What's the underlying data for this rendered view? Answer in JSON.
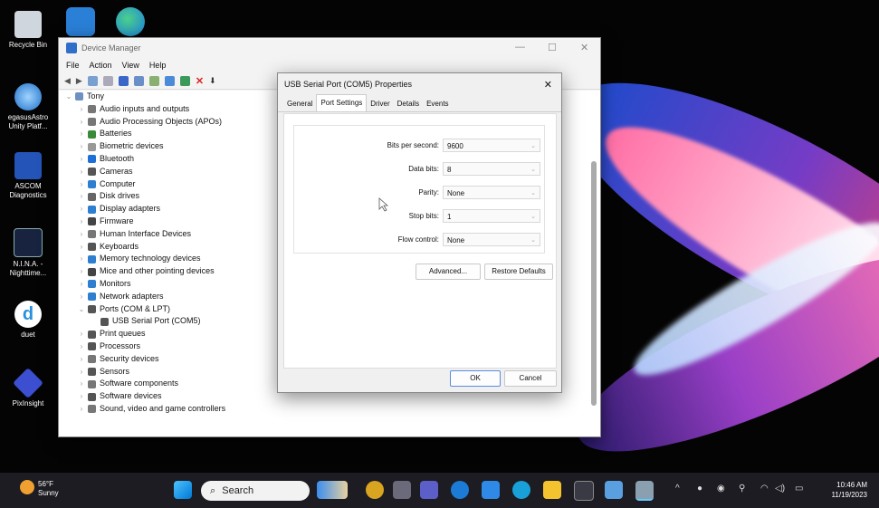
{
  "desktop": {
    "icons": [
      {
        "label": "Recycle Bin",
        "color": "#d8d8d8"
      },
      {
        "label": "egasusAstro Unity Platf...",
        "color": "#3aa0e6"
      },
      {
        "label": "ASCOM Diagnostics",
        "color": "#3a6fd6"
      },
      {
        "label": "N.I.N.A. - Nighttime...",
        "color": "#1e2f5a"
      },
      {
        "label": "duet",
        "color": "#ffffff"
      },
      {
        "label": "PixInsight",
        "color": "#3b4fd0"
      }
    ]
  },
  "device_manager": {
    "title": "Device Manager",
    "menu": [
      "File",
      "Action",
      "View",
      "Help"
    ],
    "tree_root": "Tony",
    "tree_items": [
      "Audio inputs and outputs",
      "Audio Processing Objects (APOs)",
      "Batteries",
      "Biometric devices",
      "Bluetooth",
      "Cameras",
      "Computer",
      "Disk drives",
      "Display adapters",
      "Firmware",
      "Human Interface Devices",
      "Keyboards",
      "Memory technology devices",
      "Mice and other pointing devices",
      "Monitors",
      "Network adapters",
      "Ports (COM & LPT)",
      "USB Serial Port (COM5)",
      "Print queues",
      "Processors",
      "Security devices",
      "Sensors",
      "Software components",
      "Software devices",
      "Sound, video and game controllers"
    ]
  },
  "dialog": {
    "title": "USB Serial Port (COM5) Properties",
    "tabs": [
      "General",
      "Port Settings",
      "Driver",
      "Details",
      "Events"
    ],
    "active_tab": "Port Settings",
    "fields": [
      {
        "label": "Bits per second:",
        "value": "9600"
      },
      {
        "label": "Data bits:",
        "value": "8"
      },
      {
        "label": "Parity:",
        "value": "None"
      },
      {
        "label": "Stop bits:",
        "value": "1"
      },
      {
        "label": "Flow control:",
        "value": "None"
      }
    ],
    "advanced_label": "Advanced...",
    "restore_label": "Restore Defaults",
    "ok_label": "OK",
    "cancel_label": "Cancel"
  },
  "taskbar": {
    "weather_temp": "56°F",
    "weather_text": "Sunny",
    "search_placeholder": "Search",
    "time": "10:46 AM",
    "date": "11/19/2023"
  }
}
